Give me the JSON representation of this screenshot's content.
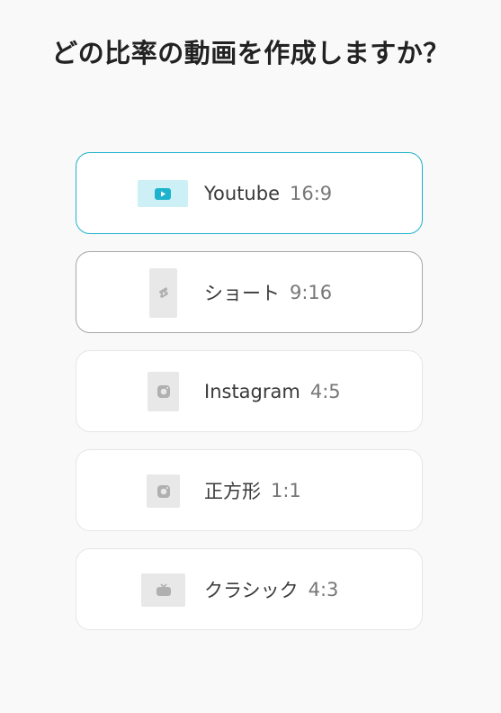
{
  "header": {
    "title": "どの比率の動画を作成しますか？"
  },
  "options": [
    {
      "name": "Youtube",
      "ratio": "16:9",
      "icon": "play-icon",
      "state": "selected"
    },
    {
      "name": "ショート",
      "ratio": "9:16",
      "icon": "shorts-icon",
      "state": "hover"
    },
    {
      "name": "Instagram",
      "ratio": "4:5",
      "icon": "instagram-icon",
      "state": "default"
    },
    {
      "name": "正方形",
      "ratio": "1:1",
      "icon": "instagram-icon",
      "state": "default"
    },
    {
      "name": "クラシック",
      "ratio": "4:3",
      "icon": "tv-icon",
      "state": "default"
    }
  ],
  "colors": {
    "accent": "#1eb3cc",
    "accent_thumb_bg": "#cdeff6",
    "thumb_bg": "#e8e8e8",
    "icon_gray": "#b0b0b0",
    "page_bg": "#f9f9f9"
  }
}
